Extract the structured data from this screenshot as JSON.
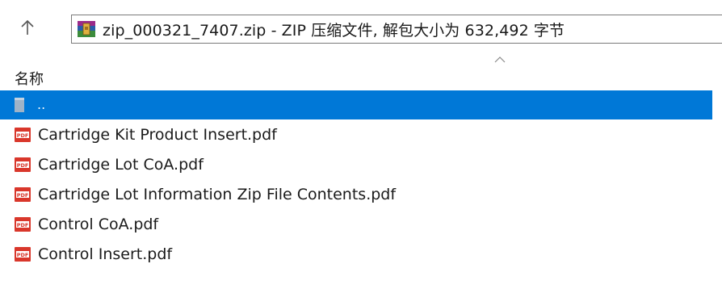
{
  "toolbar": {
    "up_icon": "up-arrow-icon",
    "address": "zip_000321_7407.zip - ZIP 压缩文件, 解包大小为 632,492 字节",
    "archive_icon": "winrar-archive-icon"
  },
  "header": {
    "name_column": "名称",
    "sort_indicator": "chevron-up-icon"
  },
  "files": [
    {
      "label": "..",
      "icon": "folder-up-icon",
      "selected": true
    },
    {
      "label": "Cartridge Kit Product Insert.pdf",
      "icon": "pdf-icon"
    },
    {
      "label": "Cartridge Lot CoA.pdf",
      "icon": "pdf-icon"
    },
    {
      "label": "Cartridge Lot Information Zip File Contents.pdf",
      "icon": "pdf-icon"
    },
    {
      "label": "Control CoA.pdf",
      "icon": "pdf-icon"
    },
    {
      "label": "Control Insert.pdf",
      "icon": "pdf-icon"
    }
  ],
  "colors": {
    "selection": "#0078d7",
    "pdf_red": "#d9372b"
  }
}
